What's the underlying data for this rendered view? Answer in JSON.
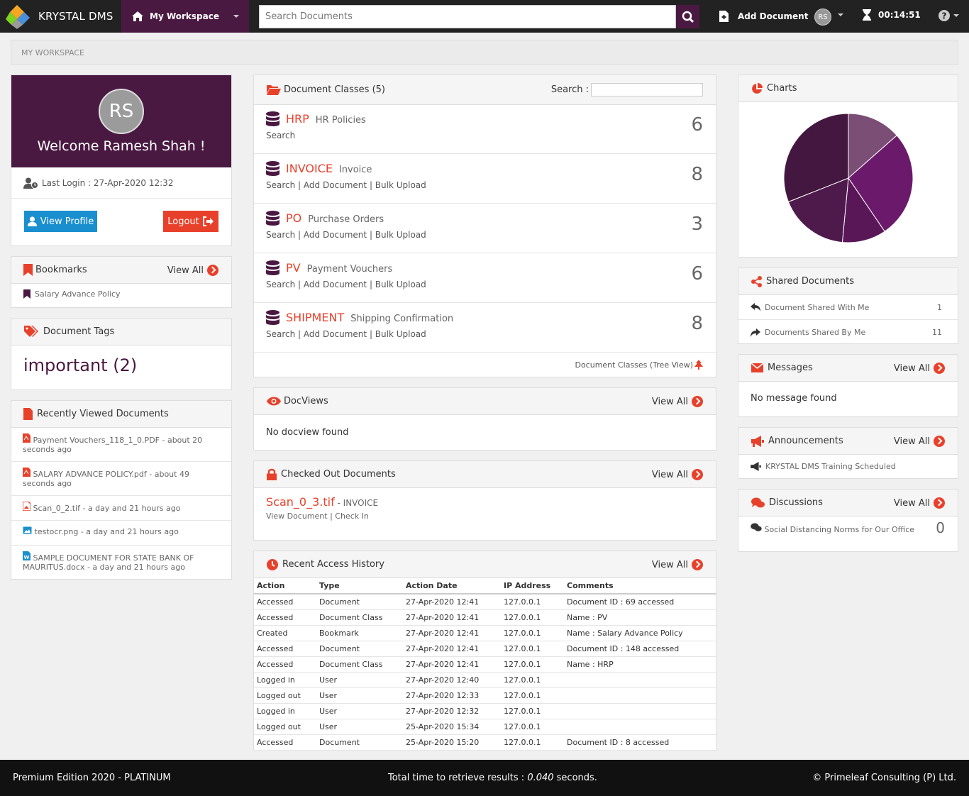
{
  "header": {
    "app_name": "KRYSTAL DMS",
    "workspace_label": "My Workspace",
    "search_placeholder": "Search Documents",
    "add_document_label": "Add Document",
    "user_initials": "RS",
    "session_timer": "00:14:51"
  },
  "breadcrumb": "MY WORKSPACE",
  "profile": {
    "initials": "RS",
    "welcome": "Welcome Ramesh Shah !",
    "last_login": "Last Login : 27-Apr-2020 12:32",
    "view_profile_label": "View Profile",
    "logout_label": "Logout"
  },
  "bookmarks": {
    "title": "Bookmarks",
    "view_all": "View All",
    "items": [
      "Salary Advance Policy"
    ]
  },
  "tags": {
    "title": "Document Tags",
    "items": [
      "important (2)"
    ]
  },
  "recent_docs": {
    "title": "Recently Viewed Documents",
    "items": [
      {
        "text": "Payment Vouchers_118_1_0.PDF - about 20 seconds ago",
        "icon": "pdf-icon"
      },
      {
        "text": "SALARY ADVANCE POLICY.pdf - about 49 seconds ago",
        "icon": "pdf-icon"
      },
      {
        "text": "Scan_0_2.tif - a day and 21 hours ago",
        "icon": "file-icon"
      },
      {
        "text": "testocr.png - a day and 21 hours ago",
        "icon": "image-icon"
      },
      {
        "text": "SAMPLE DOCUMENT FOR STATE BANK OF MAURITUS.docx - a day and 21 hours ago",
        "icon": "word-icon"
      }
    ]
  },
  "doc_classes": {
    "title": "Document Classes (5)",
    "search_label": "Search :",
    "tree_view_label": "Document Classes (Tree View)",
    "link_search": "Search",
    "link_add": "Add Document",
    "link_bulk": "Bulk Upload",
    "items": [
      {
        "code": "HRP",
        "name": "HR Policies",
        "count": "6",
        "search_only": true
      },
      {
        "code": "INVOICE",
        "name": "Invoice",
        "count": "8",
        "search_only": false
      },
      {
        "code": "PO",
        "name": "Purchase Orders",
        "count": "3",
        "search_only": false
      },
      {
        "code": "PV",
        "name": "Payment Vouchers",
        "count": "6",
        "search_only": false
      },
      {
        "code": "SHIPMENT",
        "name": "Shipping Confirmation",
        "count": "8",
        "search_only": false
      }
    ]
  },
  "docviews": {
    "title": "DocViews",
    "view_all": "View All",
    "empty": "No docview found"
  },
  "checked_out": {
    "title": "Checked Out Documents",
    "view_all": "View All",
    "doc_name": "Scan_0_3.tif",
    "doc_class": " - INVOICE",
    "link_view": "View Document",
    "link_checkin": "Check In"
  },
  "history": {
    "title": "Recent Access History",
    "view_all": "View All",
    "columns": [
      "Action",
      "Type",
      "Action Date",
      "IP Address",
      "Comments"
    ],
    "rows": [
      [
        "Accessed",
        "Document",
        "27-Apr-2020 12:41",
        "127.0.0.1",
        "Document ID : 69 accessed"
      ],
      [
        "Accessed",
        "Document Class",
        "27-Apr-2020 12:41",
        "127.0.0.1",
        "Name : PV"
      ],
      [
        "Created",
        "Bookmark",
        "27-Apr-2020 12:41",
        "127.0.0.1",
        "Name : Salary Advance Policy"
      ],
      [
        "Accessed",
        "Document",
        "27-Apr-2020 12:41",
        "127.0.0.1",
        "Document ID : 148 accessed"
      ],
      [
        "Accessed",
        "Document Class",
        "27-Apr-2020 12:41",
        "127.0.0.1",
        "Name : HRP"
      ],
      [
        "Logged in",
        "User",
        "27-Apr-2020 12:40",
        "127.0.0.1",
        ""
      ],
      [
        "Logged out",
        "User",
        "27-Apr-2020 12:33",
        "127.0.0.1",
        ""
      ],
      [
        "Logged in",
        "User",
        "27-Apr-2020 12:32",
        "127.0.0.1",
        ""
      ],
      [
        "Logged out",
        "User",
        "25-Apr-2020 15:34",
        "127.0.0.1",
        ""
      ],
      [
        "Accessed",
        "Document",
        "25-Apr-2020 15:20",
        "127.0.0.1",
        "Document ID : 8 accessed"
      ]
    ]
  },
  "charts_panel": {
    "title": "Charts"
  },
  "chart_data": {
    "type": "pie",
    "values": [
      13.5,
      27,
      11,
      17.5,
      31
    ],
    "colors": [
      "#7b4f75",
      "#6b1a6b",
      "#5a1758",
      "#4e1a4c",
      "#43173f"
    ]
  },
  "shared": {
    "title": "Shared Documents",
    "items": [
      {
        "label": "Document Shared With Me",
        "count": "1"
      },
      {
        "label": "Documents Shared By Me",
        "count": "11"
      }
    ]
  },
  "messages": {
    "title": "Messages",
    "view_all": "View All",
    "empty": "No message found"
  },
  "announcements": {
    "title": "Announcements",
    "view_all": "View All",
    "items": [
      "KRYSTAL DMS Training Scheduled"
    ]
  },
  "discussions": {
    "title": "Discussions",
    "view_all": "View All",
    "items": [
      {
        "label": "Social Distancing Norms for Our Office",
        "count": "0"
      }
    ]
  },
  "footer": {
    "edition": "Premium Edition 2020 - PLATINUM",
    "time_prefix": "Total time to retrieve results : ",
    "time_value": "0.040",
    "time_suffix": " seconds.",
    "copyright": "© Primeleaf Consulting (P) Ltd."
  },
  "colors": {
    "brand": "#4a1942",
    "accent": "#e8412b",
    "topbar": "#222222"
  }
}
